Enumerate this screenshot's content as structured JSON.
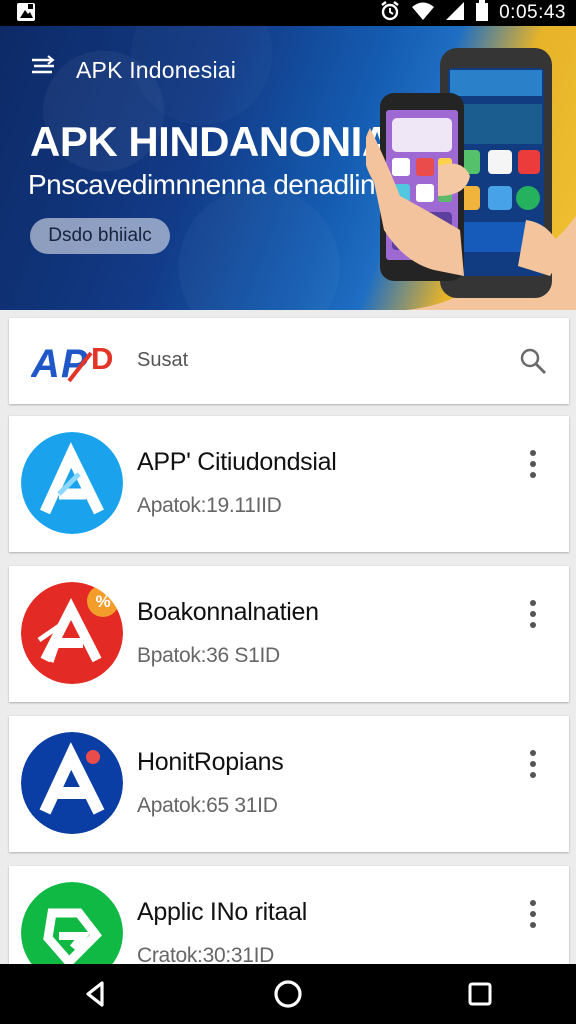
{
  "status_bar": {
    "time": "0:05:43",
    "icons": [
      "alarm-icon",
      "wifi-icon",
      "signal-icon",
      "battery-icon"
    ]
  },
  "banner": {
    "app_title": "APK Indonesiai",
    "headline": "APK HINDANONIA",
    "subheadline": "Pnscavedimnnenna denadlin",
    "button_label": "Dsdo bhiialc",
    "colors": {
      "dark_blue": "#0d2a66",
      "blue": "#145cb1",
      "yellow": "#f0c232"
    }
  },
  "search": {
    "logo_text": "APD",
    "placeholder": "Susat"
  },
  "apps": [
    {
      "name": "APP' Citiudondsial",
      "meta": "Apatok:19.11IID",
      "icon": "stylized-a-icon",
      "color": "#1aa3ec"
    },
    {
      "name": "Boakonnalnatien",
      "meta": "Bpatok:36 S1ID",
      "icon": "stylized-a-badge-icon",
      "color": "#e42a24"
    },
    {
      "name": "HonitRopians",
      "meta": "Apatok:65 31ID",
      "icon": "stylized-a-dot-icon",
      "color": "#0b3ea5"
    },
    {
      "name": "Applic INo ritaal",
      "meta": "Cratok:30:31ID",
      "icon": "green-arrow-icon",
      "color": "#10b844"
    }
  ]
}
